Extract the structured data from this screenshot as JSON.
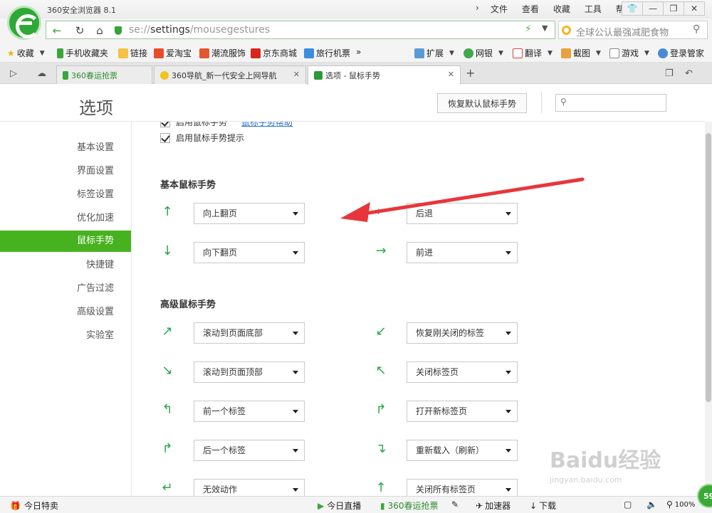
{
  "window": {
    "app_title": "360安全浏览器 8.1",
    "menu": [
      "文件",
      "查看",
      "收藏",
      "工具",
      "帮助"
    ],
    "menu_arrow": "›"
  },
  "address": {
    "url_scheme": "se://",
    "url_host": "settings",
    "url_path": "/mousegestures",
    "search_placeholder": "全球公认最强减肥食物"
  },
  "bookmarks": {
    "left": [
      "收藏",
      "手机收藏夹",
      "链接",
      "爱淘宝",
      "潮流服饰",
      "京东商城",
      "旅行机票"
    ],
    "more": "»",
    "right": [
      "扩展",
      "网银",
      "翻译",
      "截图",
      "游戏",
      "登录管家"
    ]
  },
  "tabs": [
    {
      "label": "360春运抢票"
    },
    {
      "label": "360导航_新一代安全上网导航"
    },
    {
      "label": "选项 - 鼠标手势"
    }
  ],
  "page": {
    "title": "选项",
    "restore_button": "恢复默认鼠标手势",
    "search_placeholder": "",
    "sidebar": [
      "基本设置",
      "界面设置",
      "标签设置",
      "优化加速",
      "鼠标手势",
      "快捷键",
      "广告过滤",
      "高级设置",
      "实验室"
    ],
    "active_sidebar": "鼠标手势",
    "enable_gesture": "启用鼠标手势",
    "gesture_help": "鼠标手势帮助",
    "enable_gesture_hint": "启用鼠标手势提示",
    "basic_title": "基本鼠标手势",
    "basic": [
      {
        "icon": "↑",
        "value": "向上翻页"
      },
      {
        "icon": "←",
        "value": "后退"
      },
      {
        "icon": "↓",
        "value": "向下翻页"
      },
      {
        "icon": "→",
        "value": "前进"
      }
    ],
    "advanced_title": "高级鼠标手势",
    "advanced": [
      {
        "icon": "↗",
        "value": "滚动到页面底部"
      },
      {
        "icon": "↙",
        "value": "恢复刚关闭的标签"
      },
      {
        "icon": "↘",
        "value": "滚动到页面顶部"
      },
      {
        "icon": "↖",
        "value": "关闭标签页"
      },
      {
        "icon": "↰",
        "value": "前一个标签"
      },
      {
        "icon": "↱",
        "value": "打开新标签页"
      },
      {
        "icon": "↱",
        "value": "后一个标签"
      },
      {
        "icon": "↴",
        "value": "重新载入（刷新）"
      },
      {
        "icon": "↵",
        "value": "无效动作"
      },
      {
        "icon": "↑",
        "value": "关闭所有标签页"
      }
    ]
  },
  "status": {
    "deals": "今日特卖",
    "live": "今日直播",
    "tickets": "360春运抢票",
    "accelerator": "加速器",
    "download": "下载",
    "zoom": "100%",
    "badge": "59"
  },
  "watermark": {
    "brand": "Baidu经验",
    "url": "jingyan.baidu.com"
  },
  "colors": {
    "accent_green": "#47b21f",
    "gesture_icon": "#2aa84a",
    "annotation_arrow": "#e8353c"
  }
}
